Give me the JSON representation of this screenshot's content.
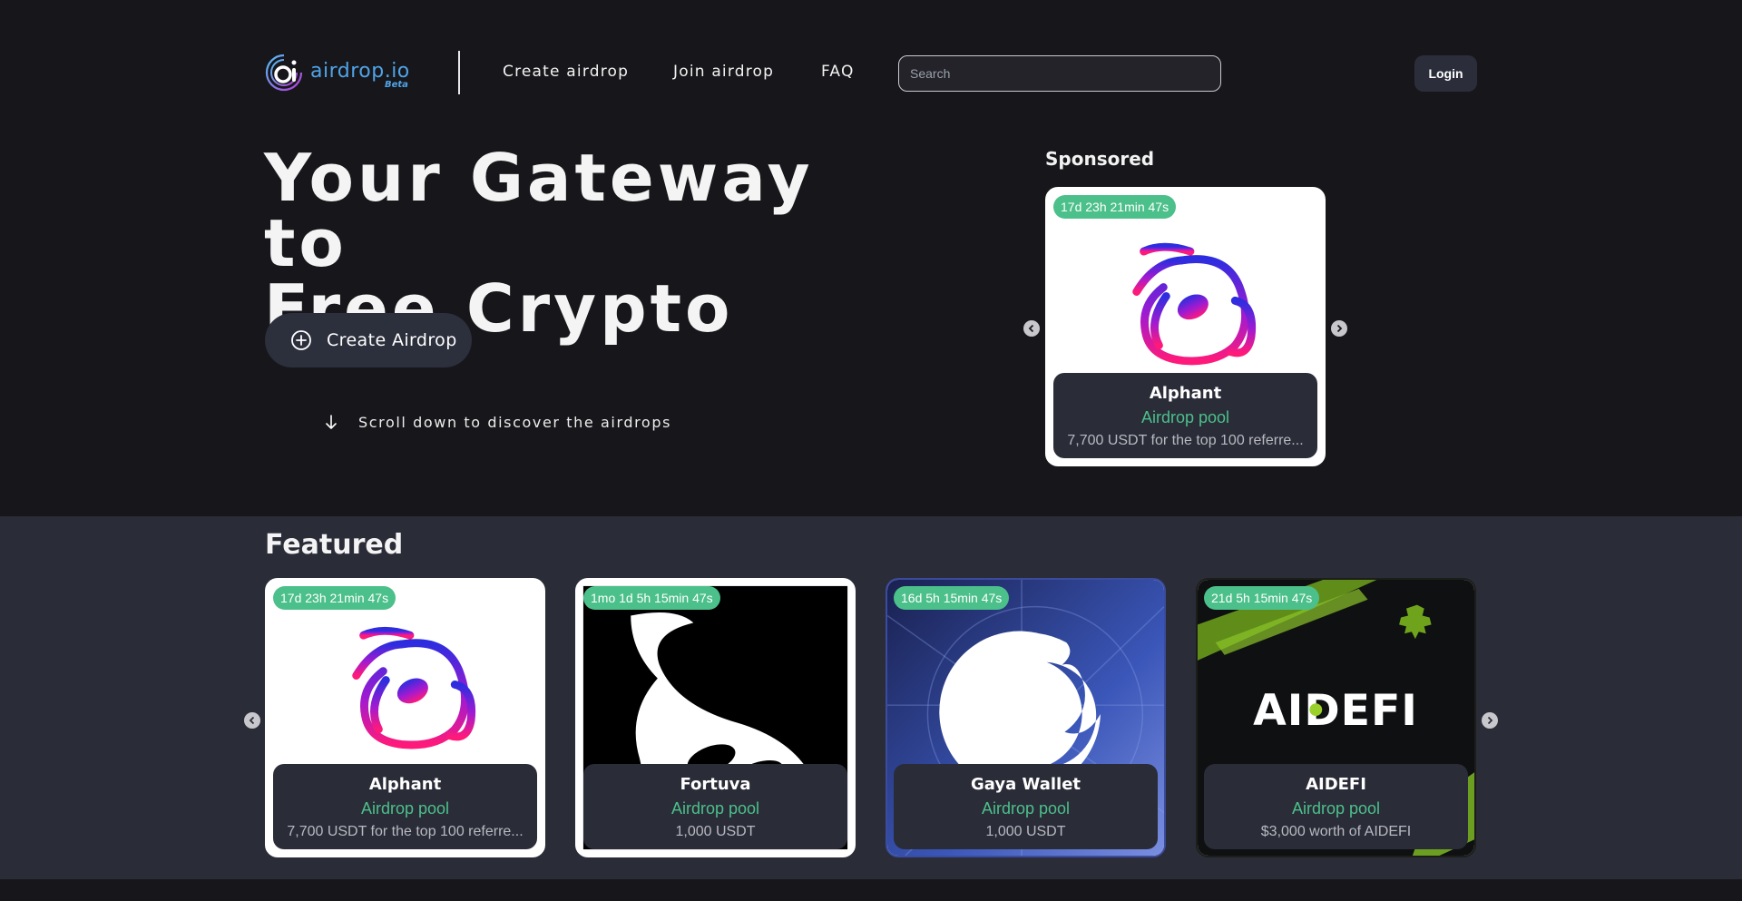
{
  "nav": {
    "logo_text": "airdrop.io",
    "logo_badge": "Beta",
    "links": [
      "Create airdrop",
      "Join airdrop",
      "FAQ"
    ],
    "search_placeholder": "Search",
    "login_label": "Login"
  },
  "hero": {
    "title_line1": "Your Gateway to",
    "title_line2": "Free Crypto",
    "create_label": "Create Airdrop",
    "scroll_hint": "Scroll down to discover the airdrops"
  },
  "sponsored": {
    "label": "Sponsored",
    "card": {
      "timer": "17d 23h 21min 47s",
      "name": "Alphant",
      "pool": "Airdrop pool",
      "desc": "7,700 USDT for the top 100 referre..."
    }
  },
  "featured": {
    "label": "Featured",
    "cards": [
      {
        "timer": "17d 23h 21min 47s",
        "name": "Alphant",
        "pool": "Airdrop pool",
        "desc": "7,700 USDT for the top 100 referre..."
      },
      {
        "timer": "1mo 1d 5h 15min 47s",
        "name": "Fortuva",
        "pool": "Airdrop pool",
        "desc": "1,000 USDT"
      },
      {
        "timer": "16d 5h 15min 47s",
        "name": "Gaya Wallet",
        "pool": "Airdrop pool",
        "desc": "1,000 USDT"
      },
      {
        "timer": "21d 5h 15min 47s",
        "name": "AIDEFI",
        "pool": "Airdrop pool",
        "desc": "$3,000 worth of AIDEFI",
        "logo_text": "AIDEFI"
      }
    ]
  },
  "colors": {
    "accent_green": "#4cc08a",
    "background": "#17171b",
    "panel": "#2a2c38"
  }
}
